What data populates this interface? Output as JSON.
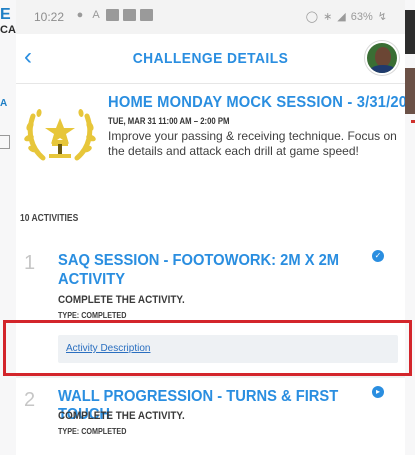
{
  "status_bar": {
    "time": "10:22",
    "battery": "63%"
  },
  "header": {
    "title": "CHALLENGE DETAILS",
    "back_icon": "chevron-left-icon",
    "avatar_icon": "user-avatar"
  },
  "challenge": {
    "title": "HOME MONDAY MOCK SESSION - 3/31/20",
    "date": "TUE, MAR 31 11:00 AM – 2:00 PM",
    "description": "Improve your passing & receiving technique. Focus on the details and attack each drill at game speed!",
    "badge_icon": "gold-laurel-star-badge"
  },
  "activities_count": "10 ACTIVITIES",
  "activities": [
    {
      "number": "1",
      "title_line1": "SAQ SESSION - FOOTOWORK: 2M X 2M",
      "title_line2": "ACTIVITY",
      "instruction": "COMPLETE THE ACTIVITY.",
      "type": "TYPE: COMPLETED",
      "link": "Activity Description",
      "status_icon": "check-circle-icon"
    },
    {
      "number": "2",
      "title_line1": "WALL PROGRESSION - TURNS & FIRST TOUCH",
      "instruction": "COMPLETE THE ACTIVITY.",
      "type": "TYPE: COMPLETED",
      "status_icon": "arrow-circle-icon"
    }
  ],
  "colors": {
    "accent": "#2a8ee0",
    "highlight": "#d3252b",
    "badge_gold": "#e7c63a"
  }
}
